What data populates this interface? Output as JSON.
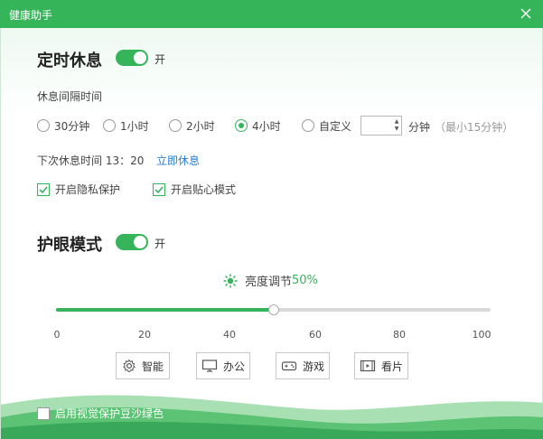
{
  "window": {
    "title": "健康助手"
  },
  "timed_rest": {
    "heading": "定时休息",
    "toggle_text": "开",
    "interval_label": "休息间隔时间",
    "options": [
      "30分钟",
      "1小时",
      "2小时",
      "4小时",
      "自定义"
    ],
    "selected_index": 3,
    "custom_value": "",
    "custom_unit": "分钟",
    "custom_hint": "（最小15分钟）",
    "next_rest_label": "下次休息时间 13：20",
    "rest_now_link": "立即休息",
    "privacy_label": "开启隐私保护",
    "privacy_checked": true,
    "care_label": "开启贴心模式",
    "care_checked": true
  },
  "eye_care": {
    "heading": "护眼模式",
    "toggle_text": "开",
    "brightness_label": "亮度调节",
    "brightness_value": "50%",
    "brightness_fraction": 0.5,
    "scale_ticks": [
      "0",
      "20",
      "40",
      "60",
      "80",
      "100"
    ],
    "modes": [
      {
        "label": "智能",
        "icon": "gear-icon"
      },
      {
        "label": "办公",
        "icon": "monitor-icon"
      },
      {
        "label": "游戏",
        "icon": "gamepad-icon"
      },
      {
        "label": "看片",
        "icon": "film-icon"
      }
    ]
  },
  "footer": {
    "green_protect_label": "启用视觉保护豆沙绿色",
    "green_protect_checked": false
  },
  "colors": {
    "accent": "#35b45a",
    "link": "#2b7fd3"
  }
}
